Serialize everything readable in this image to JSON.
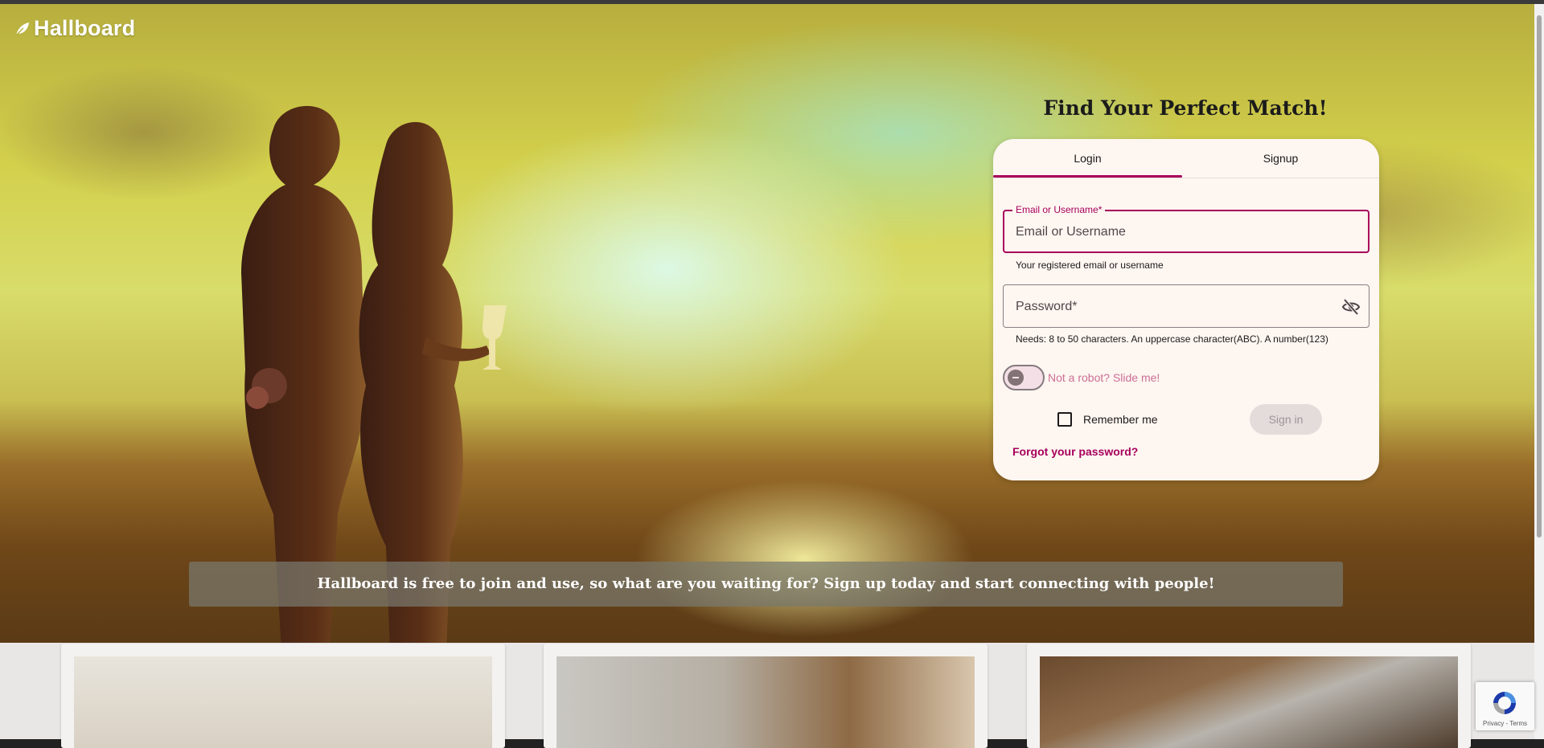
{
  "brand": {
    "name": "Hallboard"
  },
  "headline": "Find Your Perfect Match!",
  "tabs": [
    {
      "label": "Login"
    },
    {
      "label": "Signup"
    }
  ],
  "login": {
    "email": {
      "label": "Email or Username*",
      "placeholder": "Email or Username",
      "helper": "Your registered email or username"
    },
    "password": {
      "placeholder": "Password*",
      "helper": "Needs: 8 to 50 characters. An uppercase character(ABC). A number(123)"
    },
    "robot": {
      "label": "Not a robot? Slide me!"
    },
    "remember": {
      "label": "Remember me"
    },
    "submit": {
      "label": "Sign in"
    },
    "forgot": {
      "label": "Forgot your password?"
    }
  },
  "banner": {
    "text": "Hallboard is free to join and use, so what are you waiting for? Sign up today and start connecting with people!"
  },
  "recaptcha": {
    "terms": "Privacy - Terms"
  },
  "colors": {
    "accent": "#a8005c",
    "card_bg": "#fdf6f1"
  },
  "icons": {
    "logo": "leaf-icon",
    "password_toggle": "eye-off-icon",
    "captcha": "recaptcha-icon"
  }
}
